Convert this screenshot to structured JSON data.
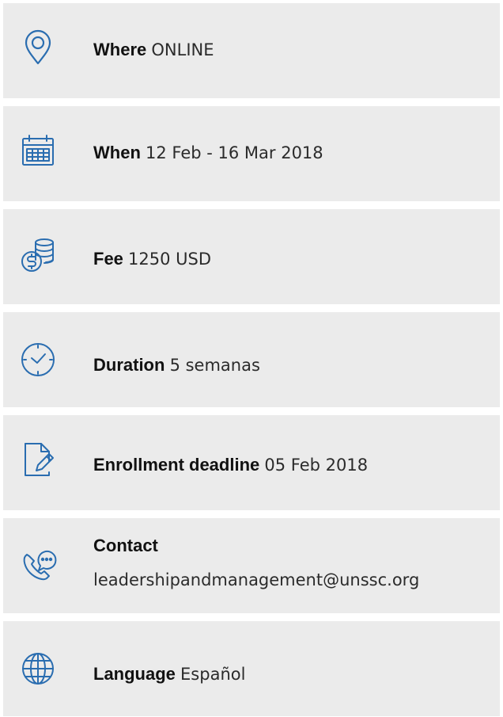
{
  "colors": {
    "row_background": "#ebebeb",
    "icon_color": "#2a6db0",
    "text_color": "#222222"
  },
  "items": [
    {
      "label": "Where",
      "value": "ONLINE",
      "icon": "location-pin-icon"
    },
    {
      "label": "When",
      "value": "12 Feb - 16 Mar 2018",
      "icon": "calendar-icon"
    },
    {
      "label": "Fee",
      "value": "1250 USD",
      "icon": "coins-icon"
    },
    {
      "label": "Duration",
      "value": "5 semanas",
      "icon": "clock-icon"
    },
    {
      "label": "Enrollment deadline",
      "value": "05 Feb 2018",
      "icon": "document-edit-icon"
    },
    {
      "label": "Contact",
      "value": "leadershipandmanagement@unssc.org",
      "icon": "phone-chat-icon"
    },
    {
      "label": "Language",
      "value": "Español",
      "icon": "globe-icon"
    }
  ]
}
